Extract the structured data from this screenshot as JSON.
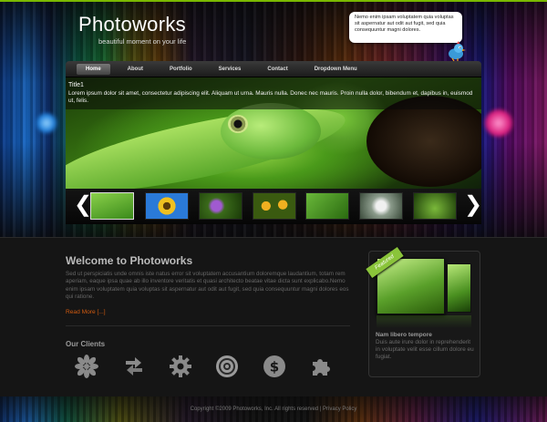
{
  "logo": {
    "title": "Photoworks",
    "tagline": "beautiful moment on your life"
  },
  "bubble": {
    "text": "Nemo enim ipsam voluptatem quia voluptas sit aspernatur aut odit aut fugit, sed quia consequuntur magni dolores."
  },
  "nav": {
    "items": [
      {
        "label": "Home",
        "active": true
      },
      {
        "label": "About"
      },
      {
        "label": "Portfolio"
      },
      {
        "label": "Services"
      },
      {
        "label": "Contact"
      },
      {
        "label": "Dropdown Menu"
      }
    ]
  },
  "slider": {
    "title": "Title1",
    "text": "Lorem ipsum dolor sit amet, consectetur adipiscing elit. Aliquam ut urna. Mauris nulla. Donec nec mauris. Proin nulla dolor, bibendum et, dapibus in, euismod ut, felis.",
    "prev_glyph": "❮",
    "next_glyph": "❯"
  },
  "welcome": {
    "title": "Welcome to Photoworks",
    "text": "Sed ut perspiciatis unde omnis iste natus error sit voluptatem accusantium doloremque laudantium, totam rem aperiam, eaque ipsa quae ab illo inventore veritatis et quasi architecto beatae vitae dicta sunt explicabo.Nemo enim ipsam voluptatem quia voluptas sit aspernatur aut odit aut fugit, sed quia consequuntur magni dolores eos qui ratione.",
    "read_more": "Read More [...]"
  },
  "clients": {
    "title": "Our Clients",
    "icons": [
      "asterisk-icon",
      "refresh-arrows-icon",
      "gear-icon",
      "target-icon",
      "dollar-icon",
      "puzzle-icon"
    ]
  },
  "featured": {
    "ribbon": "Featured",
    "title": "Nam libero tempore",
    "text": "Duis aute irure dolor in reprehenderit in voluptate velit esse cillum dolore eu fugiat."
  },
  "footer": {
    "copyright": "Copyright ©2009 Photoworks, Inc. All rights reserved",
    "separator": "|",
    "privacy": "Privacy Policy"
  },
  "colors": {
    "accent_green": "#7ab800",
    "read_more": "#d05a10"
  }
}
